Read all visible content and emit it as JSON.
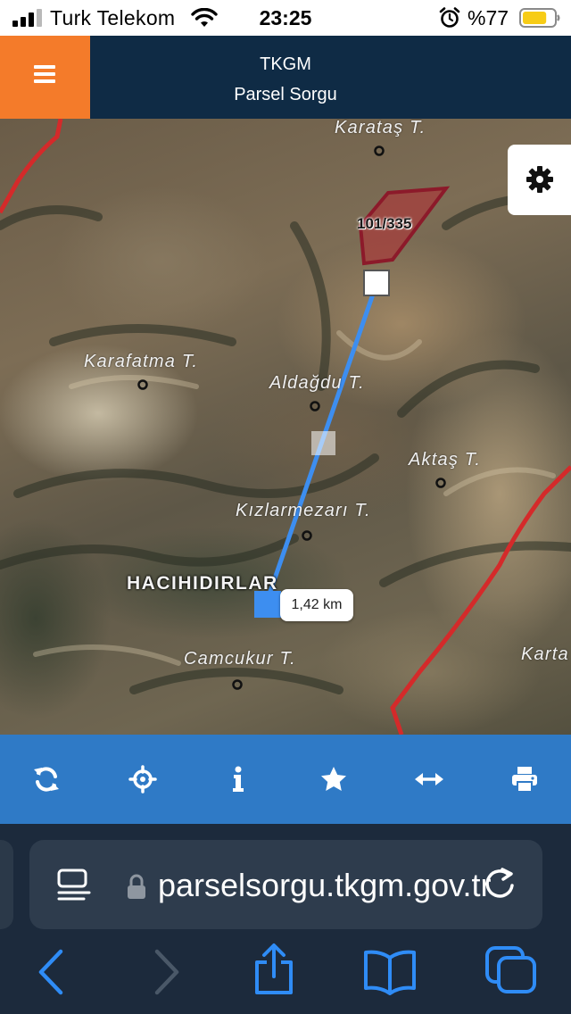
{
  "status_bar": {
    "carrier": "Turk Telekom",
    "time": "23:25",
    "battery_percent": "%77",
    "battery_level": 0.77
  },
  "header": {
    "title": "TKGM",
    "subtitle": "Parsel Sorgu"
  },
  "map": {
    "place_labels": [
      "Karataş T.",
      "Karafatma T.",
      "Aldağdu T.",
      "Aktaş T.",
      "Kızlarmezarı T.",
      "Camcukur T.",
      "Karta"
    ],
    "village_label": "HACIHIDIRLAR",
    "parcel_label": "101/335",
    "distance": "1,42 km",
    "colors": {
      "boundary": "#d42a2a",
      "parcel_fill": "#a83a3a",
      "measure_line": "#3d8ef0"
    }
  },
  "toolbar": {
    "icons": [
      "refresh-icon",
      "crosshair-icon",
      "info-icon",
      "star-icon",
      "measure-icon",
      "print-icon"
    ]
  },
  "browser": {
    "url": "parselsorgu.tkgm.gov.tr"
  }
}
